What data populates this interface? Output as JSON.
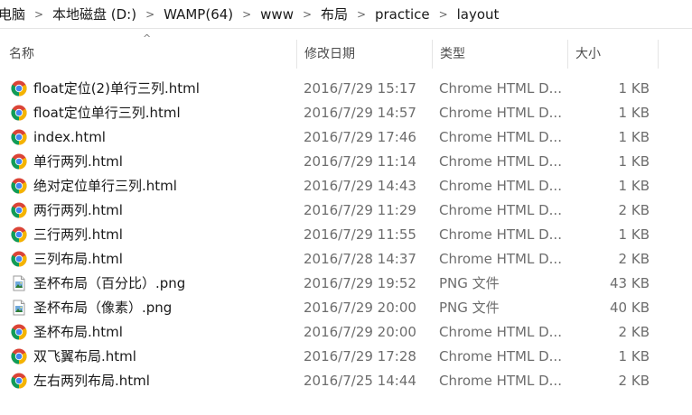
{
  "breadcrumb": [
    "电脑",
    "本地磁盘 (D:)",
    "WAMP(64)",
    "www",
    "布局",
    "practice",
    "layout"
  ],
  "columns": {
    "name": "名称",
    "date": "修改日期",
    "type": "类型",
    "size": "大小"
  },
  "files": [
    {
      "name": "float定位(2)单行三列.html",
      "date": "2016/7/29 15:17",
      "type": "Chrome HTML D...",
      "size": "1 KB",
      "icon": "chrome-icon"
    },
    {
      "name": "float定位单行三列.html",
      "date": "2016/7/29 14:57",
      "type": "Chrome HTML D...",
      "size": "1 KB",
      "icon": "chrome-icon"
    },
    {
      "name": "index.html",
      "date": "2016/7/29 17:46",
      "type": "Chrome HTML D...",
      "size": "1 KB",
      "icon": "chrome-icon"
    },
    {
      "name": "单行两列.html",
      "date": "2016/7/29 11:14",
      "type": "Chrome HTML D...",
      "size": "1 KB",
      "icon": "chrome-icon"
    },
    {
      "name": "绝对定位单行三列.html",
      "date": "2016/7/29 14:43",
      "type": "Chrome HTML D...",
      "size": "1 KB",
      "icon": "chrome-icon"
    },
    {
      "name": "两行两列.html",
      "date": "2016/7/29 11:29",
      "type": "Chrome HTML D...",
      "size": "2 KB",
      "icon": "chrome-icon"
    },
    {
      "name": "三行两列.html",
      "date": "2016/7/29 11:55",
      "type": "Chrome HTML D...",
      "size": "1 KB",
      "icon": "chrome-icon"
    },
    {
      "name": "三列布局.html",
      "date": "2016/7/28 14:37",
      "type": "Chrome HTML D...",
      "size": "2 KB",
      "icon": "chrome-icon"
    },
    {
      "name": "圣杯布局（百分比）.png",
      "date": "2016/7/29 19:52",
      "type": "PNG 文件",
      "size": "43 KB",
      "icon": "image-file-icon"
    },
    {
      "name": "圣杯布局（像素）.png",
      "date": "2016/7/29 20:00",
      "type": "PNG 文件",
      "size": "40 KB",
      "icon": "image-file-icon"
    },
    {
      "name": "圣杯布局.html",
      "date": "2016/7/29 20:00",
      "type": "Chrome HTML D...",
      "size": "2 KB",
      "icon": "chrome-icon"
    },
    {
      "name": "双飞翼布局.html",
      "date": "2016/7/29 17:28",
      "type": "Chrome HTML D...",
      "size": "1 KB",
      "icon": "chrome-icon"
    },
    {
      "name": "左右两列布局.html",
      "date": "2016/7/25 14:44",
      "type": "Chrome HTML D...",
      "size": "2 KB",
      "icon": "chrome-icon"
    }
  ]
}
